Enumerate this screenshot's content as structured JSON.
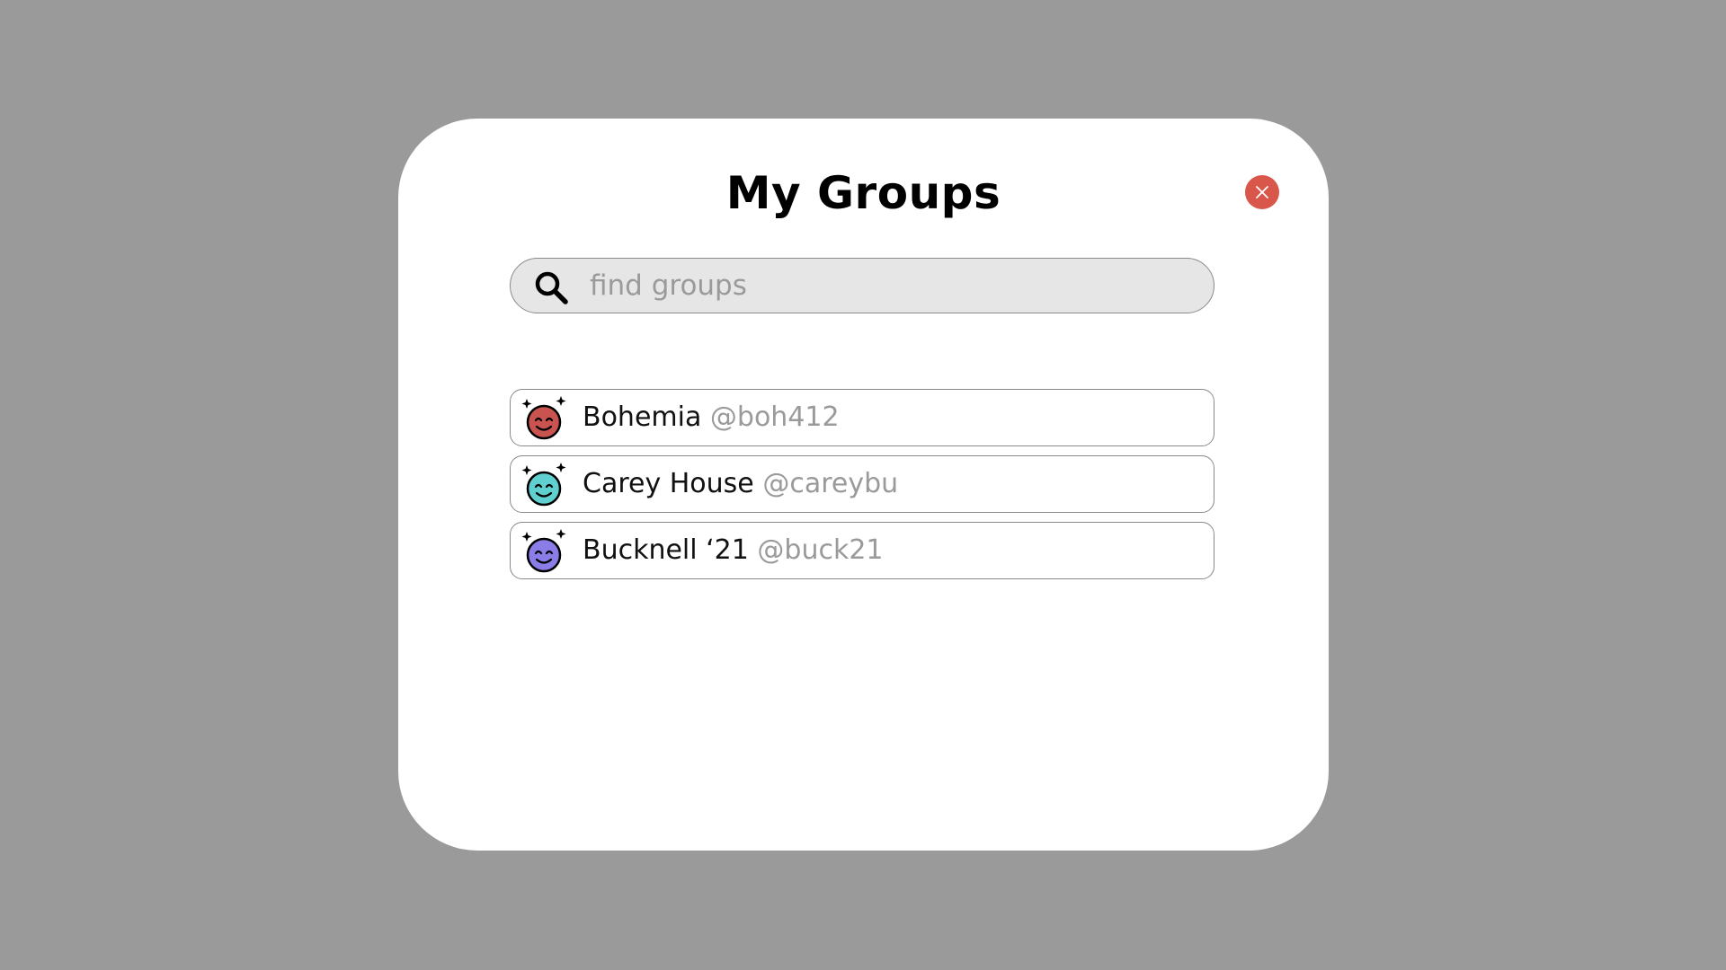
{
  "dialog": {
    "title": "My Groups"
  },
  "search": {
    "placeholder": "find groups",
    "value": ""
  },
  "groups": [
    {
      "name": "Bohemia",
      "handle": "@boh412",
      "avatar_color": "#c9534f",
      "icon": "smiling-face-sparkles-icon"
    },
    {
      "name": "Carey House",
      "handle": "@careybu",
      "avatar_color": "#5fcfcf",
      "icon": "smiling-face-sparkles-icon"
    },
    {
      "name": "Bucknell ‘21",
      "handle": "@buck21",
      "avatar_color": "#8a7de8",
      "icon": "smiling-face-sparkles-icon"
    }
  ],
  "colors": {
    "backdrop": "#9a9a9a",
    "close_button": "#d9574a",
    "search_background": "#e6e6e6"
  }
}
